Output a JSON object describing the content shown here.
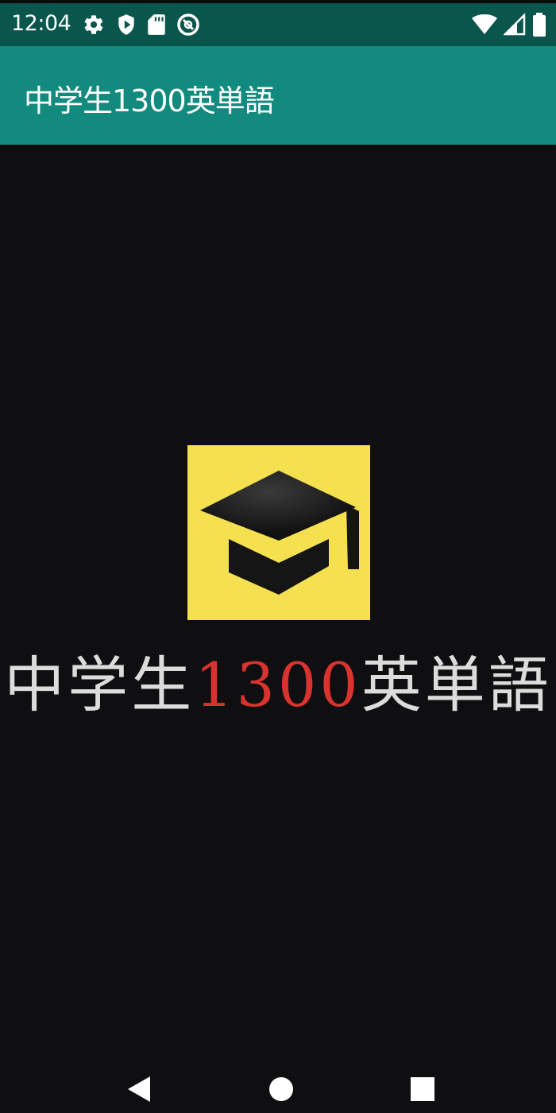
{
  "status_bar": {
    "time": "12:04",
    "left_icons": [
      "settings-icon",
      "shield-play-icon",
      "sd-card-icon",
      "data-saver-icon"
    ],
    "right_icons": [
      "wifi-icon",
      "signal-icon",
      "battery-icon"
    ]
  },
  "app_bar": {
    "title": "中学生1300英単語",
    "color": "#128a7e"
  },
  "splash": {
    "logo_icon": "graduation-cap-icon",
    "logo_bg_color": "#f5e050",
    "title_prefix": "中学生",
    "title_number": "1300",
    "title_suffix": "英単語",
    "number_color": "#d9332f"
  },
  "nav_bar": {
    "buttons": [
      "back-icon",
      "home-icon",
      "recents-icon"
    ]
  }
}
